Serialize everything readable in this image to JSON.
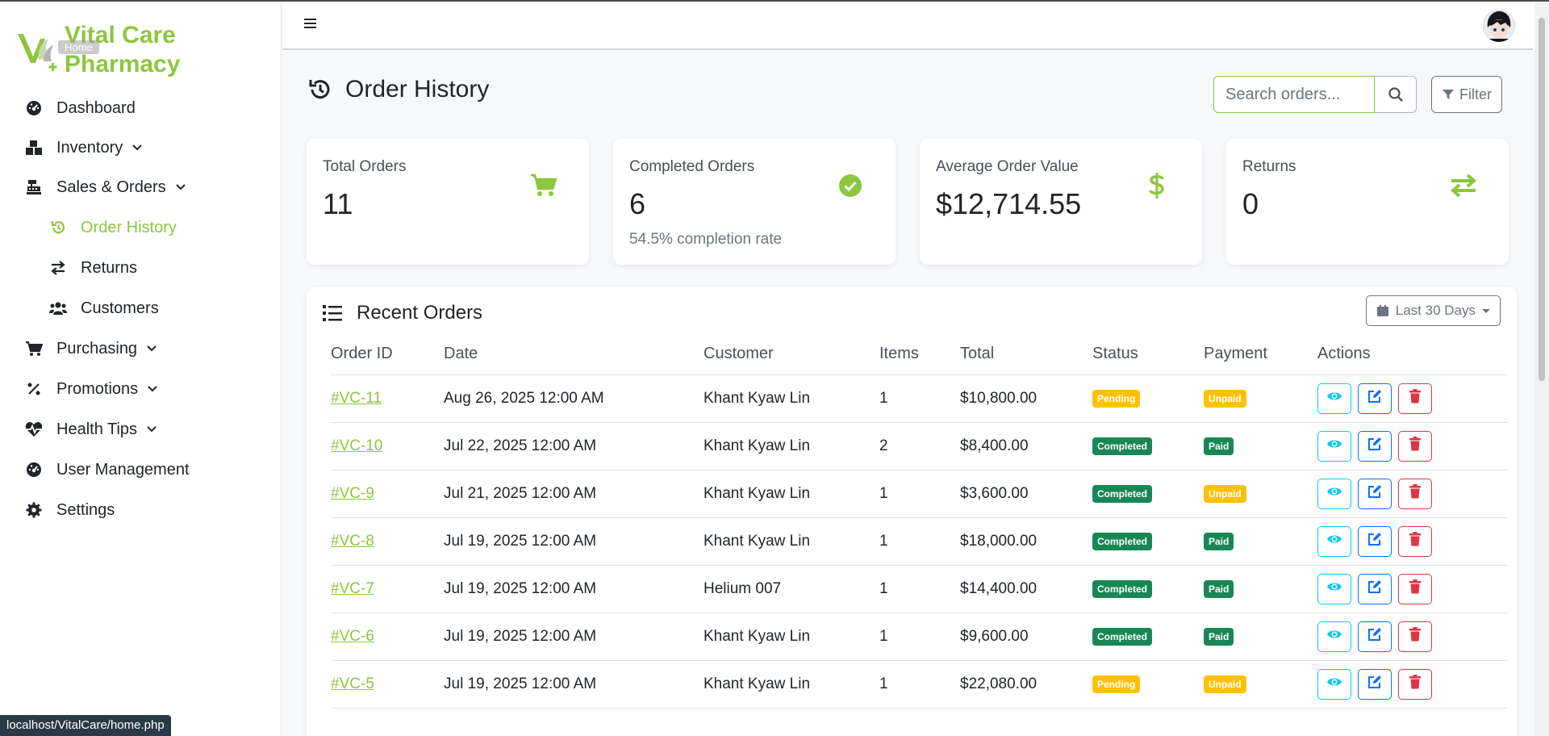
{
  "brand": {
    "name_line1": "Vital Care",
    "name_line2": "Pharmacy",
    "tooltip": "Home",
    "color": "#8dc63f"
  },
  "sidebar": {
    "items": [
      {
        "label": "Dashboard",
        "icon": "dashboard-icon"
      },
      {
        "label": "Inventory",
        "icon": "inventory-icon",
        "chevron": true
      },
      {
        "label": "Sales & Orders",
        "icon": "cash-register-icon",
        "chevron": true
      },
      {
        "label": "Order History",
        "icon": "history-icon",
        "active": true,
        "sub": true
      },
      {
        "label": "Returns",
        "icon": "exchange-icon",
        "sub": true
      },
      {
        "label": "Customers",
        "icon": "users-icon",
        "sub": true
      },
      {
        "label": "Purchasing",
        "icon": "cart-icon",
        "chevron": true
      },
      {
        "label": "Promotions",
        "icon": "percent-icon",
        "chevron": true
      },
      {
        "label": "Health Tips",
        "icon": "heartbeat-icon",
        "chevron": true
      },
      {
        "label": "User Management",
        "icon": "dashboard-icon"
      },
      {
        "label": "Settings",
        "icon": "gear-icon"
      }
    ]
  },
  "page": {
    "title": "Order History"
  },
  "search": {
    "placeholder": "Search orders...",
    "value": ""
  },
  "filter": {
    "label": "Filter"
  },
  "stats": [
    {
      "label": "Total Orders",
      "value": "11",
      "sub": "",
      "icon": "cart-icon"
    },
    {
      "label": "Completed Orders",
      "value": "6",
      "sub": "54.5% completion rate",
      "icon": "check-circle-icon"
    },
    {
      "label": "Average Order Value",
      "value": "$12,714.55",
      "sub": "",
      "icon": "dollar-icon"
    },
    {
      "label": "Returns",
      "value": "0",
      "sub": "",
      "icon": "exchange-icon"
    }
  ],
  "recent": {
    "title": "Recent Orders",
    "range": "Last 30 Days",
    "columns": [
      "Order ID",
      "Date",
      "Customer",
      "Items",
      "Total",
      "Status",
      "Payment",
      "Actions"
    ],
    "rows": [
      {
        "id": "#VC-11",
        "date": "Aug 26, 2025 12:00 AM",
        "customer": "Khant Kyaw Lin",
        "items": "1",
        "total": "$10,800.00",
        "status": "Pending",
        "payment": "Unpaid"
      },
      {
        "id": "#VC-10",
        "date": "Jul 22, 2025 12:00 AM",
        "customer": "Khant Kyaw Lin",
        "items": "2",
        "total": "$8,400.00",
        "status": "Completed",
        "payment": "Paid"
      },
      {
        "id": "#VC-9",
        "date": "Jul 21, 2025 12:00 AM",
        "customer": "Khant Kyaw Lin",
        "items": "1",
        "total": "$3,600.00",
        "status": "Completed",
        "payment": "Unpaid"
      },
      {
        "id": "#VC-8",
        "date": "Jul 19, 2025 12:00 AM",
        "customer": "Khant Kyaw Lin",
        "items": "1",
        "total": "$18,000.00",
        "status": "Completed",
        "payment": "Paid"
      },
      {
        "id": "#VC-7",
        "date": "Jul 19, 2025 12:00 AM",
        "customer": "Helium 007",
        "items": "1",
        "total": "$14,400.00",
        "status": "Completed",
        "payment": "Paid"
      },
      {
        "id": "#VC-6",
        "date": "Jul 19, 2025 12:00 AM",
        "customer": "Khant Kyaw Lin",
        "items": "1",
        "total": "$9,600.00",
        "status": "Completed",
        "payment": "Paid"
      },
      {
        "id": "#VC-5",
        "date": "Jul 19, 2025 12:00 AM",
        "customer": "Khant Kyaw Lin",
        "items": "1",
        "total": "$22,080.00",
        "status": "Pending",
        "payment": "Unpaid"
      }
    ]
  },
  "colors": {
    "accent": "#8dc63f",
    "pending": "#ffc107",
    "completed": "#198754",
    "info": "#0dcaf0",
    "primary": "#0d6efd",
    "danger": "#dc3545"
  },
  "statusbar": {
    "url": "localhost/VitalCare/home.php"
  }
}
